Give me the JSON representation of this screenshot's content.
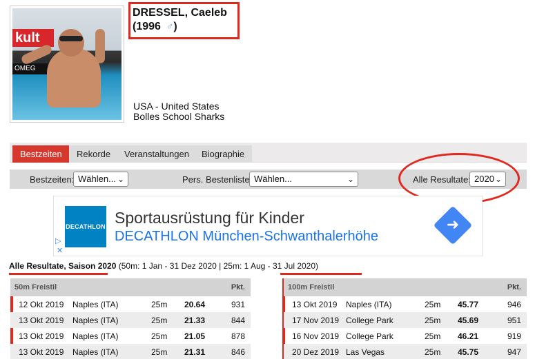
{
  "athlete": {
    "name": "DRESSEL, Caeleb",
    "year": "(1996",
    "year_close": ")",
    "gender_icon": "male-icon",
    "country": "USA - United States",
    "club": "Bolles School Sharks",
    "photo_brand": "kult",
    "photo_sponsor": "OMEG"
  },
  "tabs": [
    {
      "label": "Bestzeiten",
      "active": true
    },
    {
      "label": "Rekorde",
      "active": false
    },
    {
      "label": "Veranstaltungen",
      "active": false
    },
    {
      "label": "Biographie",
      "active": false
    }
  ],
  "filters": {
    "bestzeiten_label": "Bestzeiten:",
    "bestzeiten_value": "Wählen...",
    "pers_label": "Pers. Bestenliste:",
    "pers_value": "Wählen...",
    "alle_label": "Alle Resultate:",
    "alle_value": "2020"
  },
  "ad": {
    "logo": "DECATHLON",
    "title": "Sportausrüstung für Kinder",
    "subtitle": "DECATHLON München-Schwanthalerhöhe",
    "info_icon": "ad-info-icon",
    "close_icon": "ad-close-icon",
    "arrow_icon": "directions-arrow-icon"
  },
  "caption": {
    "bold": "Alle Resultate, Saison 2020",
    "rest": " (50m: 1 Jan - 31 Dez 2020 | 25m: 1 Aug - 31 Jul 2020)"
  },
  "tables": [
    {
      "event": "50m Freistil",
      "pts_header": "Pkt.",
      "rows": [
        {
          "date": "12 Okt 2019",
          "city": "Naples (ITA)",
          "course": "25m",
          "time": "20.64",
          "pts": "931"
        },
        {
          "date": "13 Okt 2019",
          "city": "Naples (ITA)",
          "course": "25m",
          "time": "21.33",
          "pts": "844"
        },
        {
          "date": "13 Okt 2019",
          "city": "Naples (ITA)",
          "course": "25m",
          "time": "21.05",
          "pts": "878"
        },
        {
          "date": "13 Okt 2019",
          "city": "Naples (ITA)",
          "course": "25m",
          "time": "21.31",
          "pts": "846"
        }
      ]
    },
    {
      "event": "100m Freistil",
      "pts_header": "Pkt.",
      "rows": [
        {
          "date": "13 Okt 2019",
          "city": "Naples (ITA)",
          "course": "25m",
          "time": "45.77",
          "pts": "946"
        },
        {
          "date": "17 Nov 2019",
          "city": "College Park",
          "course": "25m",
          "time": "45.69",
          "pts": "951"
        },
        {
          "date": "16 Nov 2019",
          "city": "College Park",
          "course": "25m",
          "time": "46.21",
          "pts": "919"
        },
        {
          "date": "20 Dez 2019",
          "city": "Las Vegas",
          "course": "25m",
          "time": "45.75",
          "pts": "947"
        }
      ]
    }
  ],
  "colors": {
    "accent": "#d6382e",
    "highlight": "#e0281f",
    "ad_blue": "#1a73e8",
    "decathlon": "#0082c3"
  }
}
